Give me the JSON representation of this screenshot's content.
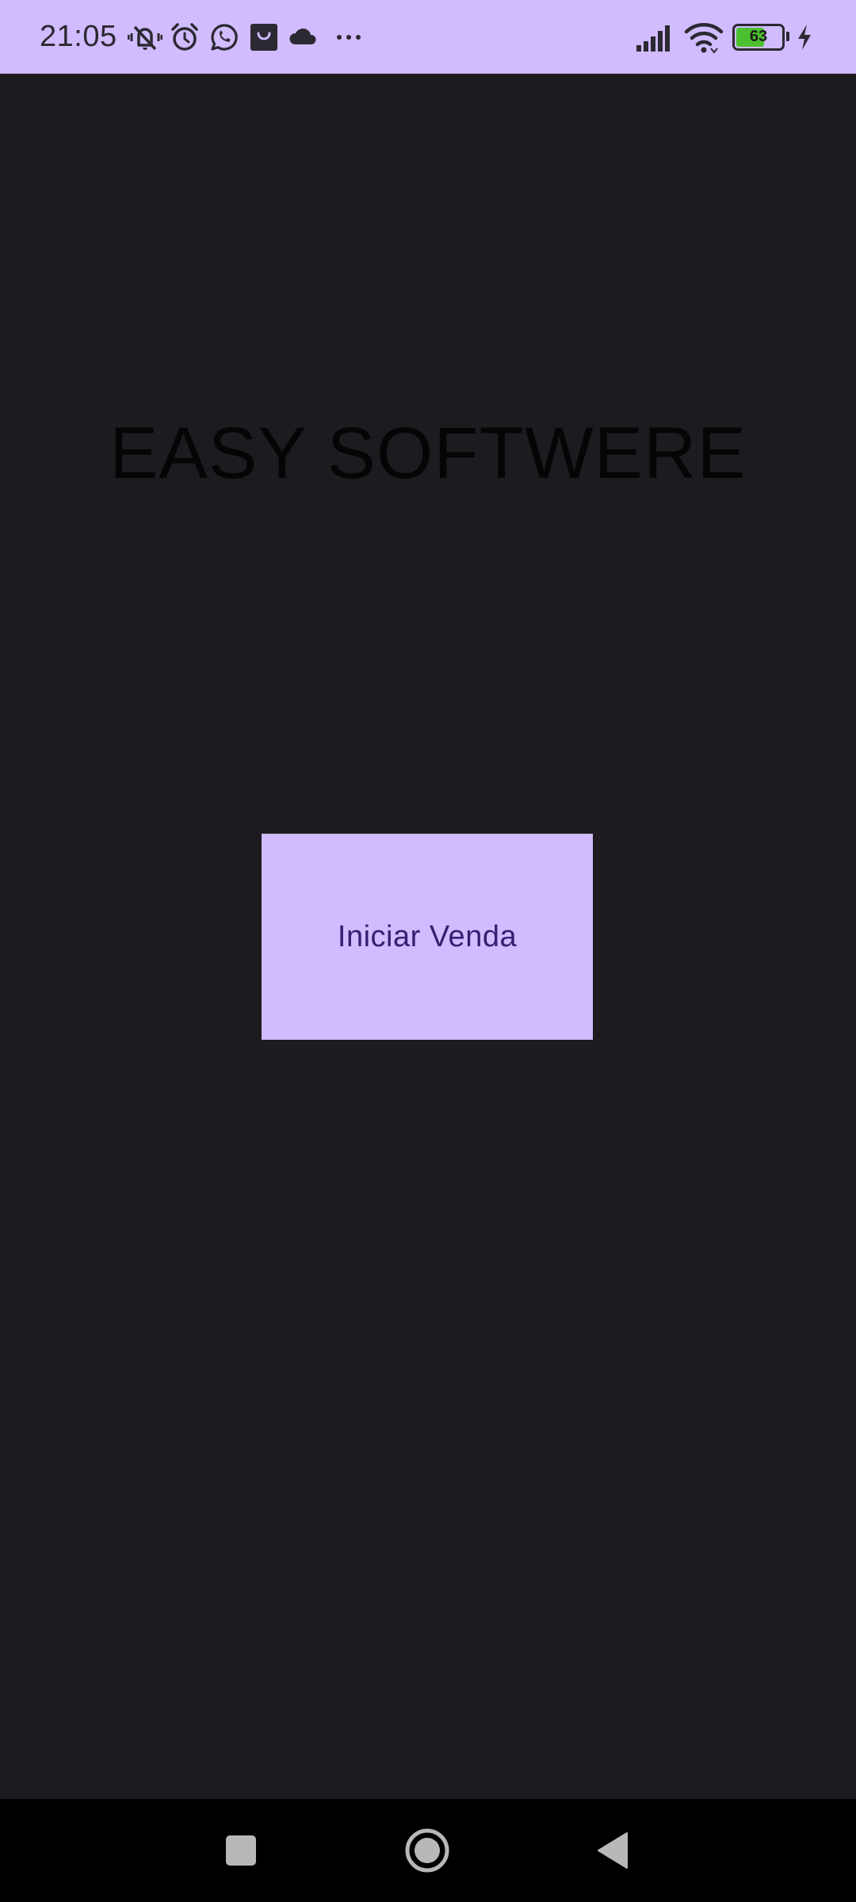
{
  "status_bar": {
    "time": "21:05",
    "battery_level": "63",
    "battery_percent": 63,
    "notification_icons": [
      "vibrate-icon",
      "alarm-icon",
      "whatsapp-icon",
      "shopping-bag-icon",
      "cloud-icon",
      "more-icon"
    ],
    "system_icons": [
      "cellular-signal-icon",
      "wifi-icon",
      "battery-icon",
      "charging-icon"
    ],
    "background_color": "#d0bcff",
    "battery_fill_color": "#4cc02e"
  },
  "main": {
    "title": "EASY SOFTWERE",
    "start_button_label": "Iniciar Venda",
    "background_color": "#1d1b20",
    "button_color": "#d0bcff",
    "button_text_color": "#381e72"
  },
  "nav_bar": {
    "buttons": [
      "recents-icon",
      "home-icon",
      "back-icon"
    ],
    "background_color": "#000000"
  }
}
